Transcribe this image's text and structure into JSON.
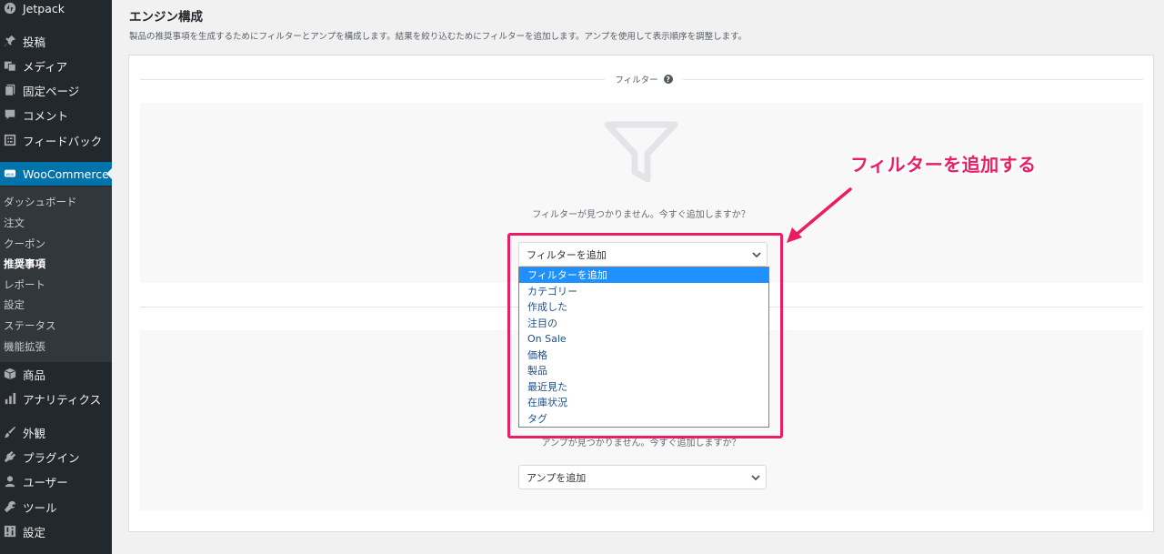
{
  "sidebar": {
    "items": [
      {
        "label": "Jetpack",
        "icon": "jetpack-icon"
      },
      {
        "label": "投稿",
        "icon": "pin-icon"
      },
      {
        "label": "メディア",
        "icon": "media-icon"
      },
      {
        "label": "固定ページ",
        "icon": "page-icon"
      },
      {
        "label": "コメント",
        "icon": "comment-icon"
      },
      {
        "label": "フィードバック",
        "icon": "feedback-icon"
      },
      {
        "label": "WooCommerce",
        "icon": "woocommerce-icon"
      },
      {
        "label": "商品",
        "icon": "box-icon"
      },
      {
        "label": "アナリティクス",
        "icon": "analytics-icon"
      },
      {
        "label": "外観",
        "icon": "appearance-icon"
      },
      {
        "label": "プラグイン",
        "icon": "plugin-icon"
      },
      {
        "label": "ユーザー",
        "icon": "user-icon"
      },
      {
        "label": "ツール",
        "icon": "wrench-icon"
      },
      {
        "label": "設定",
        "icon": "settings-icon"
      }
    ],
    "submenu": [
      {
        "label": "ダッシュボード"
      },
      {
        "label": "注文"
      },
      {
        "label": "クーポン"
      },
      {
        "label": "推奨事項"
      },
      {
        "label": "レポート"
      },
      {
        "label": "設定"
      },
      {
        "label": "ステータス"
      },
      {
        "label": "機能拡張"
      }
    ],
    "active_submenu": "推奨事項"
  },
  "main": {
    "title": "エンジン構成",
    "description": "製品の推奨事項を生成するためにフィルターとアンプを構成します。結果を絞り込むためにフィルターを追加します。アンプを使用して表示順序を調整します。",
    "filters": {
      "heading": "フィルター",
      "help_icon": "?",
      "empty_text": "フィルターが見つかりません。今すぐ追加しますか？",
      "select_value": "フィルターを追加",
      "options": [
        "フィルターを追加",
        "カテゴリー",
        "作成した",
        "注目の",
        "On Sale",
        "価格",
        "製品",
        "最近見た",
        "在庫状況",
        "タグ"
      ],
      "selected_option": "フィルターを追加"
    },
    "amps": {
      "empty_text": "アンプが見つかりません。今すぐ追加しますか？",
      "select_value": "アンプを追加"
    }
  },
  "annotation": {
    "text": "フィルターを追加する",
    "color": "#ea1f63"
  },
  "colors": {
    "sidebar_bg": "#23282d",
    "submenu_bg": "#32373c",
    "active_menu": "#0073aa",
    "selected_option": "#1e90ff",
    "highlight": "#ea1f63"
  }
}
